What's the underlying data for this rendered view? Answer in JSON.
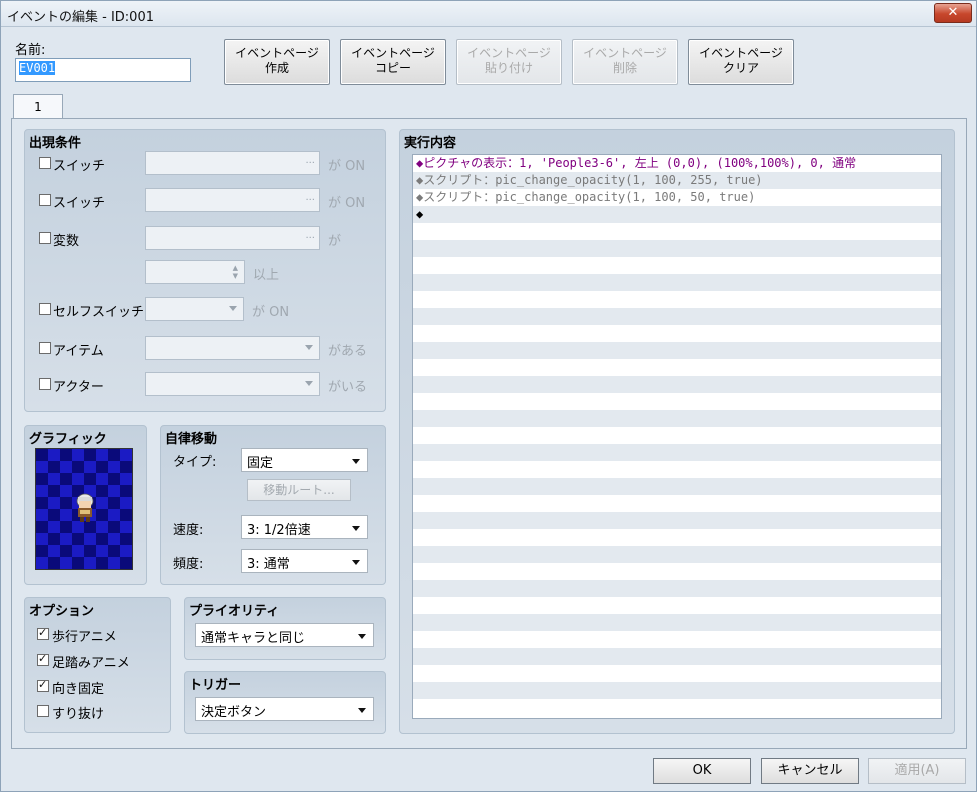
{
  "window": {
    "title": "イベントの編集 - ID:001",
    "close_glyph": "✕"
  },
  "name_label": "名前:",
  "name_value": "EV001",
  "page_buttons": [
    {
      "line1": "イベントページ",
      "line2": "作成",
      "enabled": true
    },
    {
      "line1": "イベントページ",
      "line2": "コピー",
      "enabled": true
    },
    {
      "line1": "イベントページ",
      "line2": "貼り付け",
      "enabled": false
    },
    {
      "line1": "イベントページ",
      "line2": "削除",
      "enabled": false
    },
    {
      "line1": "イベントページ",
      "line2": "クリア",
      "enabled": true
    }
  ],
  "tab": {
    "label": "1"
  },
  "conditions": {
    "title": "出現条件",
    "switch1": {
      "label": "スイッチ",
      "suffix": "が ON",
      "checked": false,
      "dots": "..."
    },
    "switch2": {
      "label": "スイッチ",
      "suffix": "が ON",
      "checked": false,
      "dots": "..."
    },
    "variable": {
      "label": "変数",
      "suffix": "が",
      "checked": false,
      "dots": "...",
      "above": "以上"
    },
    "self_switch": {
      "label": "セルフスイッチ",
      "suffix": "が ON",
      "checked": false
    },
    "item": {
      "label": "アイテム",
      "suffix": "がある",
      "checked": false
    },
    "actor": {
      "label": "アクター",
      "suffix": "がいる",
      "checked": false
    }
  },
  "graphic": {
    "title": "グラフィック"
  },
  "autonomous": {
    "title": "自律移動",
    "type_label": "タイプ:",
    "type_value": "固定",
    "route_button": "移動ルート...",
    "speed_label": "速度:",
    "speed_value": "3: 1/2倍速",
    "freq_label": "頻度:",
    "freq_value": "3: 通常"
  },
  "options": {
    "title": "オプション",
    "items": [
      {
        "label": "歩行アニメ",
        "checked": true
      },
      {
        "label": "足踏みアニメ",
        "checked": true
      },
      {
        "label": "向き固定",
        "checked": true
      },
      {
        "label": "すり抜け",
        "checked": false
      }
    ]
  },
  "priority": {
    "title": "プライオリティ",
    "value": "通常キャラと同じ"
  },
  "trigger": {
    "title": "トリガー",
    "value": "決定ボタン"
  },
  "contents": {
    "title": "実行内容",
    "lines": [
      {
        "text": "◆ピクチャの表示：1, 'People3-6', 左上 (0,0), (100%,100%), 0, 通常",
        "color": "purple"
      },
      {
        "text": "◆スクリプト：pic_change_opacity(1, 100, 255, true)",
        "color": "gray"
      },
      {
        "text": "◆スクリプト：pic_change_opacity(1, 100, 50, true)",
        "color": "gray"
      },
      {
        "text": "◆",
        "color": "black"
      }
    ],
    "total_rows": 33
  },
  "footer": {
    "ok": "OK",
    "cancel": "キャンセル",
    "apply": "適用(A)"
  }
}
